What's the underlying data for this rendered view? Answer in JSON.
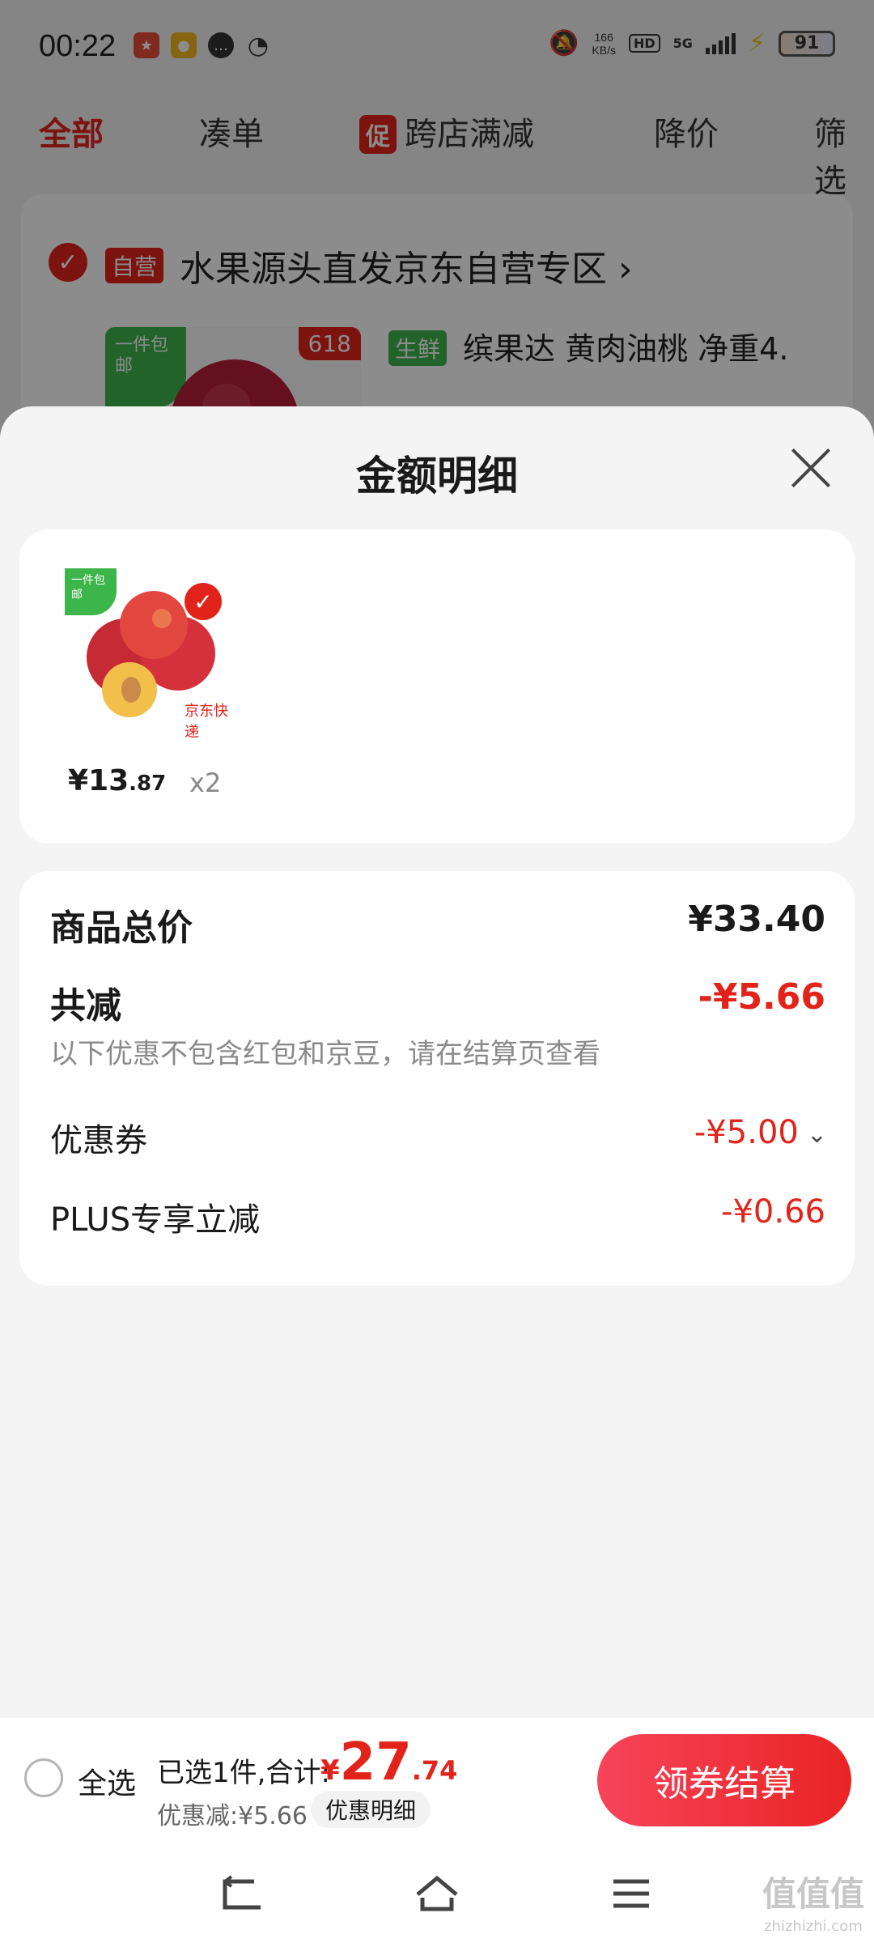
{
  "status_bar": {
    "time": "00:22",
    "net_speed_value": "166",
    "net_speed_unit": "KB/s",
    "hd_label": "HD",
    "network": "5G",
    "battery": "91"
  },
  "tabs": {
    "all": "全部",
    "bundle": "凑单",
    "promo_tag": "促",
    "cross_store": "跨店满减",
    "price_drop": "降价",
    "filter": "筛选"
  },
  "store": {
    "self_tag": "自营",
    "name": "水果源头直发京东自营专区",
    "free_ship": "一件包邮",
    "tag_618": "618",
    "fresh_tag": "生鲜",
    "product_title": "缤果达 黄肉油桃 净重4."
  },
  "sheet": {
    "title": "金额明细",
    "goods": {
      "free_ship": "一件包邮",
      "express": "京东快递",
      "price_currency": "¥",
      "price_int": "13",
      "price_dec": ".87",
      "qty": "x2"
    },
    "detail": {
      "subtotal_label": "商品总价",
      "subtotal_value": "¥33.40",
      "total_off_label": "共减",
      "total_off_value": "-¥5.66",
      "note": "以下优惠不包含红包和京豆，请在结算页查看",
      "coupon_label": "优惠券",
      "coupon_value": "-¥5.00",
      "plus_label": "PLUS专享立减",
      "plus_value": "-¥0.66"
    }
  },
  "action_bar": {
    "select_all": "全选",
    "summary": "已选1件,合计:",
    "total_currency": "¥",
    "total_int": "27",
    "total_dec": ".74",
    "discount": "优惠减:¥5.66",
    "detail_chip": "优惠明细",
    "checkout": "领券结算"
  },
  "watermark": {
    "text": "值值值",
    "site": "zhizhizhi.com"
  },
  "colors": {
    "accent_red": "#e2231a",
    "fresh_green": "#3cb54a",
    "sheet_bg": "#f4f4f4"
  }
}
